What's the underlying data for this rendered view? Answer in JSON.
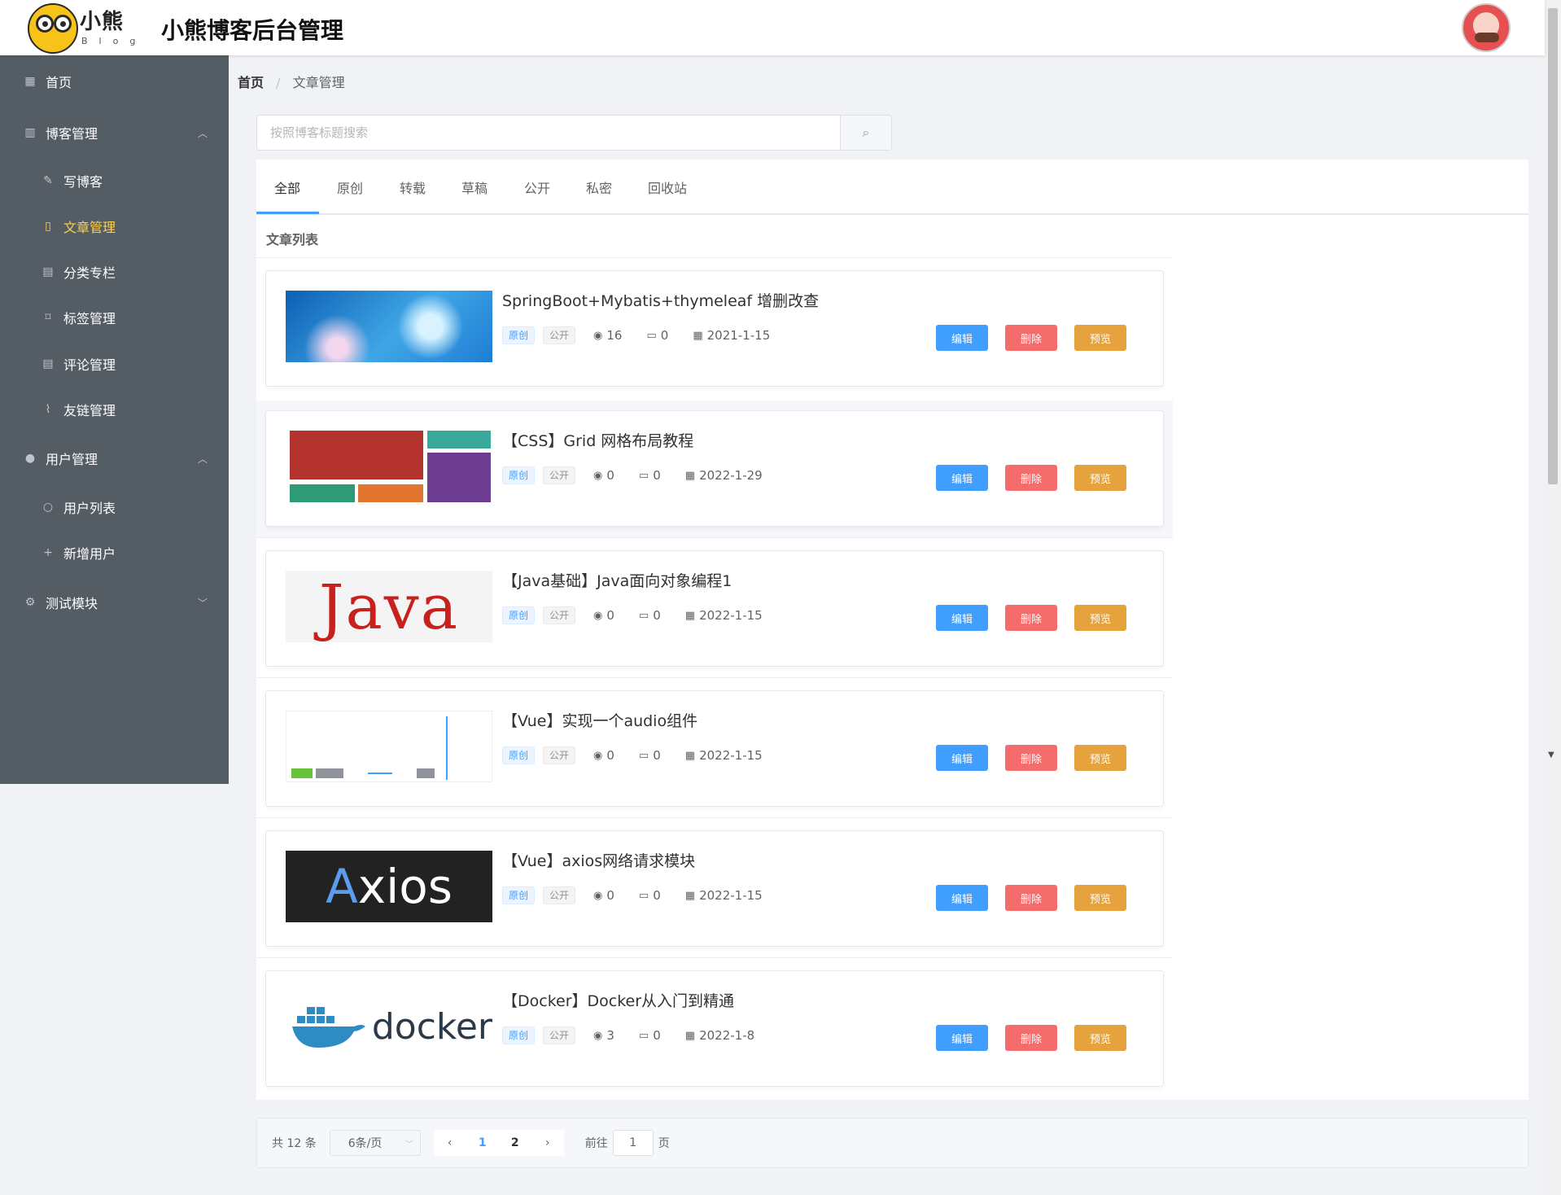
{
  "header": {
    "logo_text": "小熊",
    "logo_sub": "Blog",
    "app_title": "小熊博客后台管理"
  },
  "sidebar": {
    "items": [
      {
        "label": "首页",
        "icon": "grid-icon"
      },
      {
        "label": "博客管理",
        "icon": "book-icon"
      },
      {
        "label": "写博客",
        "icon": "pen-icon"
      },
      {
        "label": "文章管理",
        "icon": "notebook-icon"
      },
      {
        "label": "分类专栏",
        "icon": "document-icon"
      },
      {
        "label": "标签管理",
        "icon": "bookmark-icon"
      },
      {
        "label": "评论管理",
        "icon": "comment-doc-icon"
      },
      {
        "label": "友链管理",
        "icon": "paperclip-icon"
      },
      {
        "label": "用户管理",
        "icon": "user-icon"
      },
      {
        "label": "用户列表",
        "icon": "user-outline-icon"
      },
      {
        "label": "新增用户",
        "icon": "plus-icon"
      },
      {
        "label": "测试模块",
        "icon": "gear-icon"
      }
    ],
    "active_color": "#ffd04b",
    "bg_color": "#545c64"
  },
  "breadcrumb": {
    "home": "首页",
    "sep": "/",
    "current": "文章管理"
  },
  "search": {
    "placeholder": "按照博客标题搜索",
    "value": ""
  },
  "tabs": [
    "全部",
    "原创",
    "转载",
    "草稿",
    "公开",
    "私密",
    "回收站"
  ],
  "list_title": "文章列表",
  "actions": {
    "edit": "编辑",
    "delete": "删除",
    "preview": "预览"
  },
  "articles": [
    {
      "title": "SpringBoot+Mybatis+thymeleaf 增删改查",
      "type": "原创",
      "visibility": "公开",
      "views": "16",
      "comments": "0",
      "date": "2021-1-15"
    },
    {
      "title": "【CSS】Grid 网格布局教程",
      "type": "原创",
      "visibility": "公开",
      "views": "0",
      "comments": "0",
      "date": "2022-1-29"
    },
    {
      "title": "【Java基础】Java面向对象编程1",
      "type": "原创",
      "visibility": "公开",
      "views": "0",
      "comments": "0",
      "date": "2022-1-15"
    },
    {
      "title": "【Vue】实现一个audio组件",
      "type": "原创",
      "visibility": "公开",
      "views": "0",
      "comments": "0",
      "date": "2022-1-15"
    },
    {
      "title": "【Vue】axios网络请求模块",
      "type": "原创",
      "visibility": "公开",
      "views": "0",
      "comments": "0",
      "date": "2022-1-15"
    },
    {
      "title": "【Docker】Docker从入门到精通",
      "type": "原创",
      "visibility": "公开",
      "views": "3",
      "comments": "0",
      "date": "2022-1-8"
    }
  ],
  "thumbs": {
    "java": "Java",
    "axios_a": "A",
    "axios_rest": "xios",
    "docker": "docker"
  },
  "pagination": {
    "total": "共 12 条",
    "page_size": "6条/页",
    "pages": [
      "1",
      "2"
    ],
    "current_page": "1",
    "goto_label": "前往",
    "goto_value": "1",
    "page_suffix": "页"
  },
  "colors": {
    "primary": "#409eff",
    "danger": "#f56c6c",
    "warning": "#e6a23c"
  }
}
